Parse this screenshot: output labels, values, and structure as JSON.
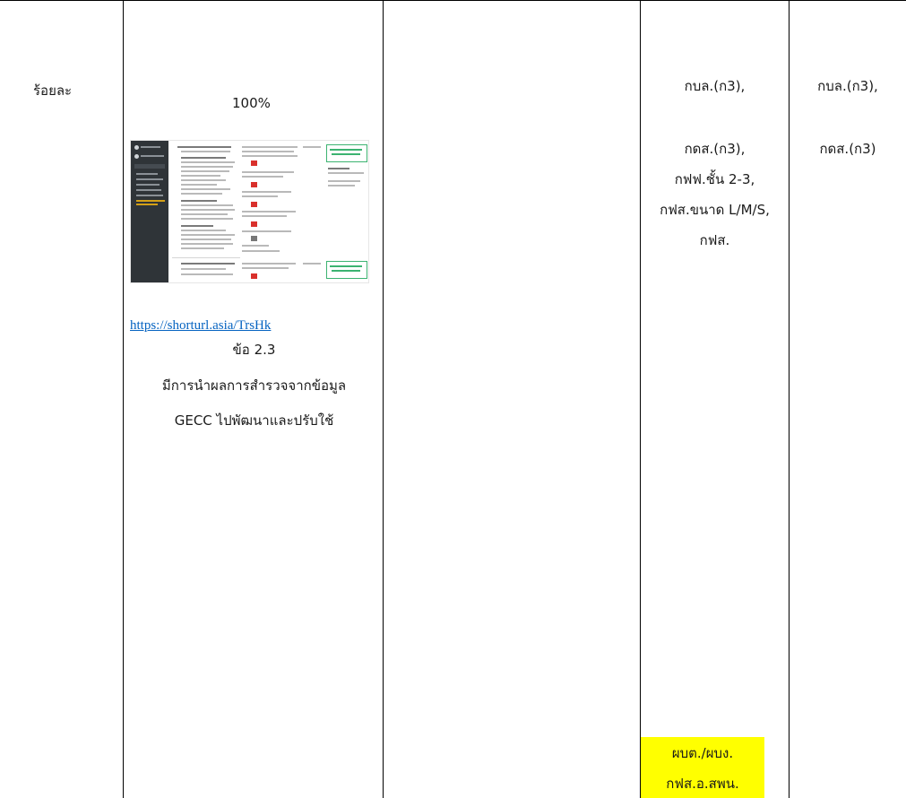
{
  "unit_label": "ร้อยละ",
  "target": "100%",
  "evidence": {
    "link_text": "https://shorturl.asia/TrsHk",
    "clause": "ข้อ 2.3",
    "description_line1": "มีการนำผลการสำรวจจากข้อมูล",
    "description_line2": "GECC ไปพัฒนาและปรับใช้"
  },
  "responsible_units": {
    "line1": "กบล.(ก3),",
    "line2": "กดส.(ก3),",
    "line3": "กฟฟ.ชั้น 2-3,",
    "line4": "กฟส.ขนาด L/M/S,",
    "line5": "กฟส."
  },
  "supporting_units": {
    "line1": "กบล.(ก3),",
    "line2": "กดส.(ก3)"
  },
  "highlighted": {
    "line1": "ผบต./ผบง.",
    "line2": "กฟส.อ.สพน."
  },
  "colors": {
    "link": "#0563c1",
    "highlight": "#ffff00",
    "border": "#000000"
  }
}
